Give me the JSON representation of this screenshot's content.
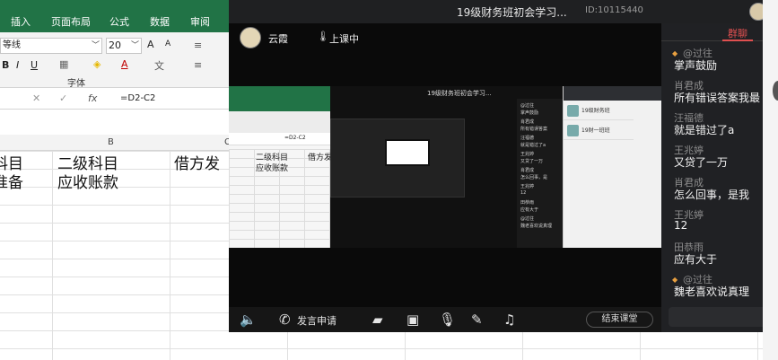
{
  "excel": {
    "tabs": [
      "插入",
      "页面布局",
      "公式",
      "数据",
      "审阅"
    ],
    "font_name": "等线",
    "font_size": "20",
    "group_label": "字体",
    "formula": "=D2-C2",
    "fx_label": "fx",
    "columns": [
      "B",
      "C"
    ],
    "cells": {
      "a1": "科目",
      "b1": "二级科目",
      "c1": "借方发",
      "a2": "准备",
      "b2": "应收账款"
    },
    "bold": "B",
    "italic": "I",
    "underline": "U",
    "grow_font": "A",
    "shrink_font": "A"
  },
  "classroom": {
    "title": "19级财务班初会学习...",
    "id_text": "ID:10115440",
    "host_name": "云霞",
    "live_status": "上课中",
    "apply_speak": "发言申请",
    "end_class": "结束课堂",
    "share": {
      "formula": "=D2-C2",
      "cells": [
        "二级科目",
        "应收账款",
        "借方发"
      ],
      "nested_title": "19级财务班初会学习...",
      "chat_lines": [
        "@过往",
        "掌声鼓励",
        "肖君成",
        "所有错误答案",
        "汪福德",
        "就是错过了a",
        "王兆婷",
        "又贷了一万",
        "肖君成",
        "怎么回事，是",
        "王兆婷",
        "12",
        "田恭雨",
        "应有大于",
        "@过往",
        "魏老喜欢说真理"
      ],
      "wechat_items": [
        "19级财务班",
        "19财一班班"
      ]
    }
  },
  "chat": {
    "tab_label": "群聊",
    "messages": [
      {
        "name": "@过往",
        "text": "掌声鼓励",
        "tagged": true
      },
      {
        "name": "肖君成",
        "text": "所有错误答案我最",
        "tagged": false
      },
      {
        "name": "汪福德",
        "text": "就是错过了a",
        "tagged": false
      },
      {
        "name": "王兆婷",
        "text": "又贷了一万",
        "tagged": false
      },
      {
        "name": "肖君成",
        "text": "怎么回事，是我",
        "tagged": false
      },
      {
        "name": "王兆婷",
        "text": "12",
        "tagged": false
      },
      {
        "name": "田恭雨",
        "text": "应有大于",
        "tagged": false
      },
      {
        "name": "@过往",
        "text": "魏老喜欢说真理",
        "tagged": true
      }
    ]
  }
}
